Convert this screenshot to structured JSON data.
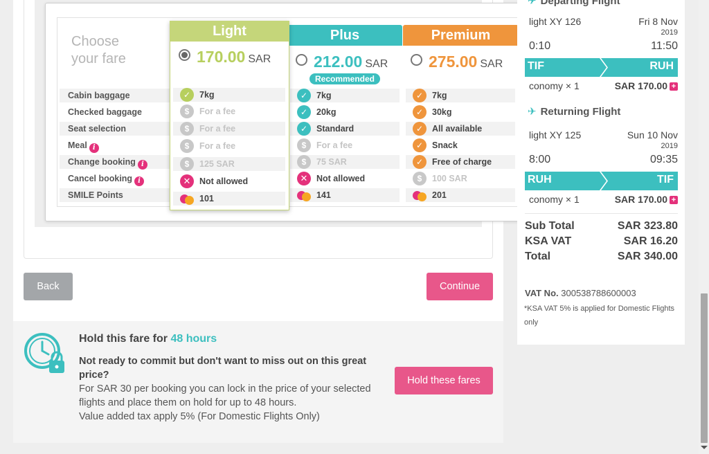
{
  "fare": {
    "choose_label": "Choose\nyour fare",
    "recommended": "Recommended",
    "row_labels": [
      "Cabin baggage",
      "Checked baggage",
      "Seat selection",
      "Meal",
      "Change booking",
      "Cancel booking",
      "SMILE Points"
    ],
    "light": {
      "name": "Light",
      "price": "170.00",
      "currency": "SAR",
      "color": "#b7cf5e",
      "cells": [
        "7kg",
        "For a fee",
        "For a fee",
        "For a fee",
        "125 SAR",
        "Not allowed",
        "101"
      ]
    },
    "plus": {
      "name": "Plus",
      "price": "212.00",
      "currency": "SAR",
      "color": "#3cbfbf",
      "cells": [
        "7kg",
        "20kg",
        "Standard",
        "For a fee",
        "75 SAR",
        "Not allowed",
        "141"
      ]
    },
    "premium": {
      "name": "Premium",
      "price": "275.00",
      "currency": "SAR",
      "color": "#ef953c",
      "cells": [
        "7kg",
        "30kg",
        "All available",
        "Snack",
        "Free of charge",
        "100 SAR",
        "201"
      ]
    }
  },
  "buttons": {
    "back": "Back",
    "continue": "Continue",
    "hold": "Hold these fares"
  },
  "hold": {
    "title_prefix": "Hold this fare for",
    "hours": "48 hours",
    "bold_text": "Not ready to commit but don't want to miss out on this great price?",
    "line1": "For SAR 30 per booking you can lock in the price of your selected flights and place them on hold for up to 48 hours.",
    "line2": "Value added tax apply 5% (For Domestic Flights Only)"
  },
  "summary": {
    "departing_title": "Departing Flight",
    "departing": {
      "flight": "light XY 126",
      "day": "Fri 8 Nov",
      "year": "2019",
      "dep_time": "0:10",
      "arr_time": "11:50",
      "from": "TIF",
      "to": "RUH",
      "cabin": "conomy × 1",
      "price": "SAR 170.00"
    },
    "returning_title": "Returning Flight",
    "returning": {
      "flight": "light XY 125",
      "day": "Sun 10 Nov",
      "year": "2019",
      "dep_time": "8:00",
      "arr_time": "09:35",
      "from": "RUH",
      "to": "TIF",
      "cabin": "conomy × 1",
      "price": "SAR 170.00"
    },
    "subtotal_label": "Sub Total",
    "subtotal": "SAR 323.80",
    "vat_label": "KSA VAT",
    "vat": "SAR 16.20",
    "total_label": "Total",
    "total": "SAR 340.00",
    "vat_no_label": "VAT No.",
    "vat_no": "300538788600003",
    "vat_note": "*KSA VAT 5% is applied for Domestic Flights only"
  },
  "colors": {
    "accent_teal": "#3cbfbf",
    "accent_pink": "#e8578a",
    "light_green": "#b7cf5e",
    "premium_orange": "#ef953c"
  }
}
